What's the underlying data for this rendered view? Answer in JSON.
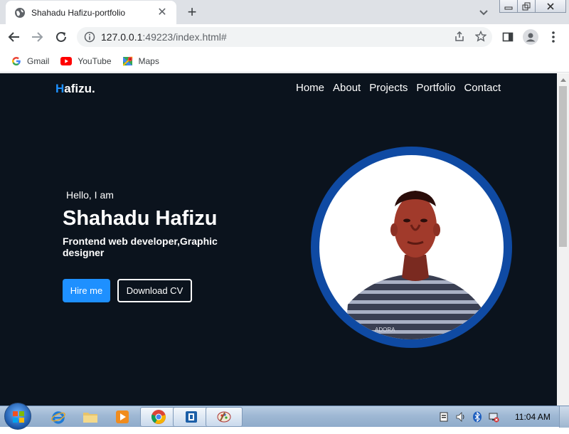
{
  "browser": {
    "tab_title": "Shahadu Hafizu-portfolio",
    "url_host": "127.0.0.1",
    "url_rest": ":49223/index.html#",
    "bookmarks": [
      {
        "label": "Gmail",
        "icon": "google-icon"
      },
      {
        "label": "YouTube",
        "icon": "youtube-icon"
      },
      {
        "label": "Maps",
        "icon": "maps-icon"
      }
    ]
  },
  "site": {
    "brand_first": "H",
    "brand_rest": "afizu.",
    "nav": [
      "Home",
      "About",
      "Projects",
      "Portfolio",
      "Contact"
    ],
    "greeting": "Hello, I am",
    "name": "Shahadu Hafizu",
    "role": "Frontend web developer,Graphic designer",
    "hire_label": "Hire me",
    "cv_label": "Download CV",
    "photo_shirt_text": "ADORA"
  },
  "taskbar": {
    "clock": "11:04 AM"
  },
  "colors": {
    "page_bg": "#0b131d",
    "accent": "#1e90ff",
    "ring": "#0f4aa3"
  }
}
